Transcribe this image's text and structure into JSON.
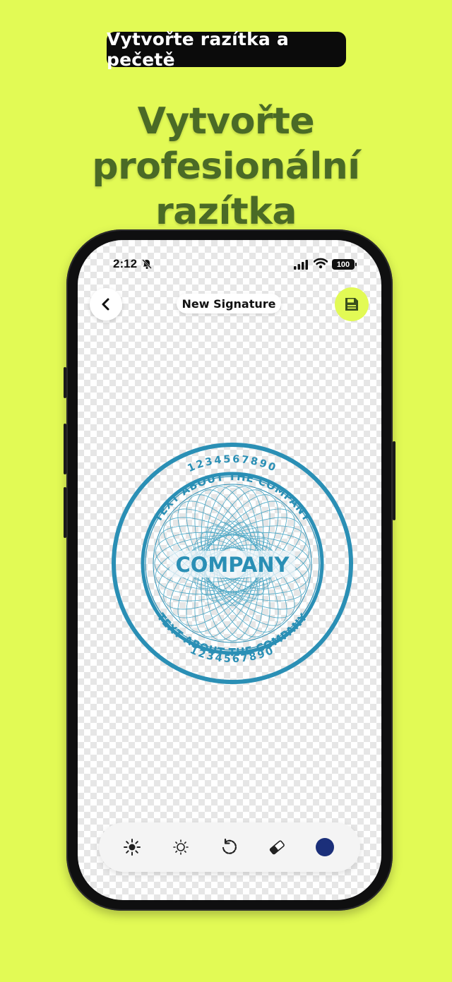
{
  "banner": {
    "label": "Vytvořte razítka a pečetě"
  },
  "headline": {
    "line1": "Vytvořte profesionální",
    "line2": "razítka"
  },
  "status_bar": {
    "time": "2:12",
    "battery": "100"
  },
  "editor": {
    "title": "New Signature",
    "back_icon": "chevron-left-icon",
    "save_icon": "floppy-disk-icon"
  },
  "stamp": {
    "center_text": "COMPANY",
    "inner_ring_text": "TEXT ABOUT THE COMPANY",
    "outer_ring_text": "1234567890",
    "color": "#2a8fb5"
  },
  "toolbar": {
    "tools": [
      "brightness-icon",
      "contrast-icon",
      "rotate-icon",
      "eraser-icon",
      "color-picker"
    ],
    "selected_color": "#1b2f7a"
  },
  "colors": {
    "background": "#e2fa55",
    "headline": "#4a6a26"
  }
}
